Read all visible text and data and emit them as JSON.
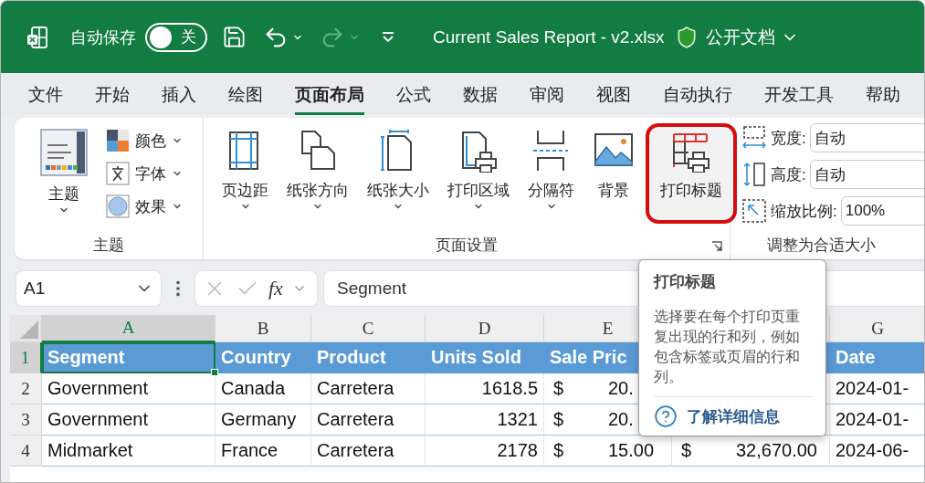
{
  "title_bar": {
    "autosave_label": "自动保存",
    "autosave_toggle": {
      "on": false,
      "label": "关"
    },
    "redo": {
      "disabled": true
    },
    "file_name": "Current Sales Report - v2.xlsx",
    "sensitivity_label": "公开文档"
  },
  "tabs": [
    {
      "label": "文件",
      "selected": false
    },
    {
      "label": "开始",
      "selected": false
    },
    {
      "label": "插入",
      "selected": false
    },
    {
      "label": "绘图",
      "selected": false
    },
    {
      "label": "页面布局",
      "selected": true
    },
    {
      "label": "公式",
      "selected": false
    },
    {
      "label": "数据",
      "selected": false
    },
    {
      "label": "审阅",
      "selected": false
    },
    {
      "label": "视图",
      "selected": false
    },
    {
      "label": "自动执行",
      "selected": false
    },
    {
      "label": "开发工具",
      "selected": false
    },
    {
      "label": "帮助",
      "selected": false
    }
  ],
  "ribbon": {
    "theme_group": {
      "label": "主题",
      "theme_button": {
        "label": "主题"
      },
      "options": [
        {
          "label": "颜色"
        },
        {
          "label": "字体"
        },
        {
          "label": "效果"
        }
      ]
    },
    "page_setup_group": {
      "label": "页面设置",
      "buttons": [
        {
          "label": "页边距",
          "dropdown": true,
          "highlighted": false
        },
        {
          "label": "纸张方向",
          "dropdown": true,
          "highlighted": false
        },
        {
          "label": "纸张大小",
          "dropdown": true,
          "highlighted": false
        },
        {
          "label": "打印区域",
          "dropdown": true,
          "highlighted": false
        },
        {
          "label": "分隔符",
          "dropdown": true,
          "highlighted": false
        },
        {
          "label": "背景",
          "dropdown": false,
          "highlighted": false
        },
        {
          "label": "打印标题",
          "dropdown": false,
          "highlighted": true
        }
      ]
    },
    "scale_group": {
      "label": "调整为合适大小",
      "fields": [
        {
          "label": "宽度:",
          "value": "自动"
        },
        {
          "label": "高度:",
          "value": "自动"
        },
        {
          "label": "缩放比例:",
          "value": "100%"
        }
      ]
    }
  },
  "formula_bar": {
    "name_box": "A1",
    "function_label": "fx",
    "formula": "Segment"
  },
  "sheet": {
    "columns": [
      {
        "letter": "A",
        "selected": true
      },
      {
        "letter": "B",
        "selected": false
      },
      {
        "letter": "C",
        "selected": false
      },
      {
        "letter": "D",
        "selected": false
      },
      {
        "letter": "E",
        "selected": false
      },
      {},
      {
        "letter": "G",
        "selected": false
      }
    ],
    "rows": [
      {
        "number": "1",
        "selected": true,
        "cells": [
          {
            "kind": "header",
            "text": "Segment",
            "active": true
          },
          {
            "kind": "header",
            "text": "Country",
            "active": false
          },
          {
            "kind": "header",
            "text": "Product",
            "active": false
          },
          {
            "kind": "header",
            "text": "Units Sold",
            "active": false
          },
          {
            "kind": "header",
            "text": "Sale Pric",
            "active": false
          },
          {
            "kind": "covered_header"
          },
          {
            "kind": "header",
            "text": "Date",
            "active": false
          }
        ]
      },
      {
        "number": "2",
        "selected": false,
        "cells": [
          {
            "kind": "text",
            "text": "Government",
            "active": false
          },
          {
            "kind": "text",
            "text": "Canada",
            "active": false
          },
          {
            "kind": "text",
            "text": "Carretera",
            "active": false
          },
          {
            "kind": "number",
            "text": "1618.5",
            "active": false
          },
          {
            "kind": "currency",
            "symbol": "$",
            "text": "20.",
            "active": false
          },
          {
            "kind": "covered"
          },
          {
            "kind": "text",
            "text": "2024-01-",
            "active": false
          }
        ]
      },
      {
        "number": "3",
        "selected": false,
        "cells": [
          {
            "kind": "text",
            "text": "Government",
            "active": false
          },
          {
            "kind": "text",
            "text": "Germany",
            "active": false
          },
          {
            "kind": "text",
            "text": "Carretera",
            "active": false
          },
          {
            "kind": "number",
            "text": "1321",
            "active": false
          },
          {
            "kind": "currency",
            "symbol": "$",
            "text": "20.",
            "active": false
          },
          {
            "kind": "covered"
          },
          {
            "kind": "text",
            "text": "2024-01-",
            "active": false
          }
        ]
      },
      {
        "number": "4",
        "selected": false,
        "cells": [
          {
            "kind": "text",
            "text": "Midmarket",
            "active": false
          },
          {
            "kind": "text",
            "text": "France",
            "active": false
          },
          {
            "kind": "text",
            "text": "Carretera",
            "active": false
          },
          {
            "kind": "number",
            "text": "2178",
            "active": false
          },
          {
            "kind": "currency",
            "symbol": "$",
            "text": "15.00",
            "active": false
          },
          {
            "kind": "currency",
            "symbol": "$",
            "text": "32,670.00",
            "active": false
          },
          {
            "kind": "text",
            "text": "2024-06-",
            "active": false
          }
        ]
      }
    ]
  },
  "tooltip": {
    "title": "打印标题",
    "body": "选择要在每个打印页重复出现的行和列，例如包含标签或页眉的行和列。",
    "link": "了解详细信息"
  }
}
